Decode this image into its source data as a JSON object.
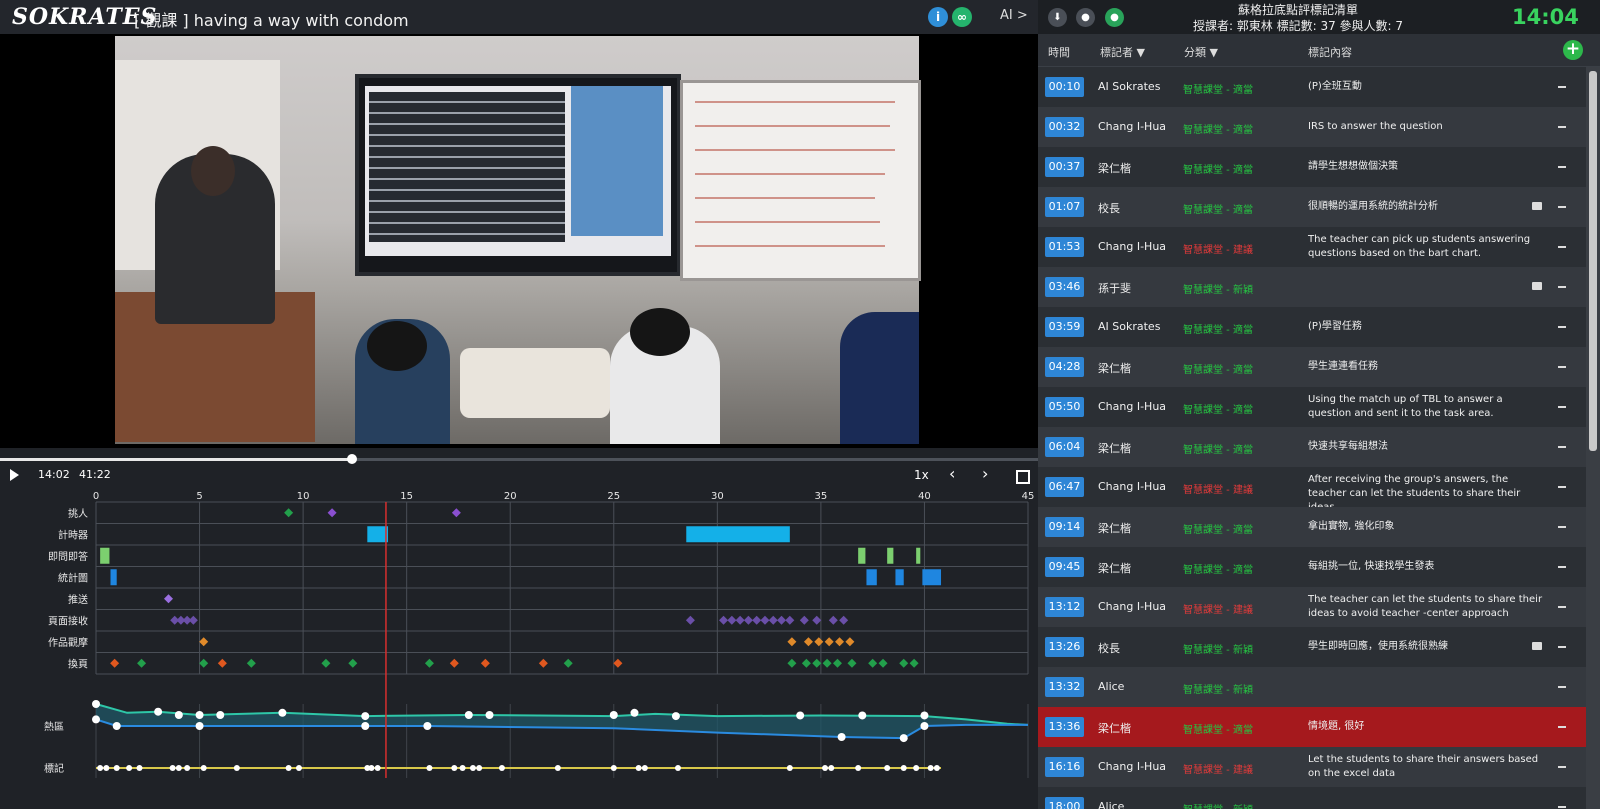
{
  "app": {
    "logo": "SOKRATES",
    "lesson_title": "[ 觀課 ] having a way with condom",
    "info_icon": "i",
    "link_icon": "∞",
    "ai_toggle": "AI >"
  },
  "player": {
    "current_time": "14:02",
    "total_time": "41:22",
    "progress_pct": 33.9,
    "speed": "1x",
    "prev_icon": "‹",
    "next_icon": "›"
  },
  "timeline": {
    "x_ticks": [
      0,
      5,
      10,
      15,
      20,
      25,
      30,
      35,
      40,
      45
    ],
    "x_max": 45,
    "playhead_min": 14.0,
    "rows": [
      {
        "label": "挑人",
        "marks": [
          {
            "t": 9.3,
            "c": "#22a04b",
            "s": "diamond"
          },
          {
            "t": 11.4,
            "c": "#8a4fd0",
            "s": "diamond"
          },
          {
            "t": 17.4,
            "c": "#8a4fd0",
            "s": "diamond"
          }
        ]
      },
      {
        "label": "計時器",
        "marks": [
          {
            "t": 13.1,
            "w": 1.0,
            "c": "#14b0e8",
            "s": "bar"
          },
          {
            "t": 28.5,
            "w": 5.0,
            "c": "#14b0e8",
            "s": "bar"
          }
        ]
      },
      {
        "label": "即問即答",
        "marks": [
          {
            "t": 0.2,
            "w": 0.45,
            "c": "#7ccf6f",
            "s": "bar"
          },
          {
            "t": 36.8,
            "w": 0.35,
            "c": "#7ccf6f",
            "s": "bar"
          },
          {
            "t": 38.2,
            "w": 0.3,
            "c": "#7ccf6f",
            "s": "bar"
          },
          {
            "t": 39.6,
            "w": 0.2,
            "c": "#7ccf6f",
            "s": "bar"
          }
        ]
      },
      {
        "label": "統計圖",
        "marks": [
          {
            "t": 0.7,
            "w": 0.3,
            "c": "#1f86e0",
            "s": "bar"
          },
          {
            "t": 37.2,
            "w": 0.5,
            "c": "#1f86e0",
            "s": "bar"
          },
          {
            "t": 38.6,
            "w": 0.4,
            "c": "#1f86e0",
            "s": "bar"
          },
          {
            "t": 39.9,
            "w": 0.9,
            "c": "#1f86e0",
            "s": "bar"
          }
        ]
      },
      {
        "label": "推送",
        "marks": [
          {
            "t": 3.5,
            "c": "#9a6fe0",
            "s": "diamond"
          }
        ]
      },
      {
        "label": "頁面接收",
        "marks": [
          {
            "t": 3.8,
            "c": "#6a4fa8",
            "s": "diamond"
          },
          {
            "t": 4.1,
            "c": "#6a4fa8",
            "s": "diamond"
          },
          {
            "t": 4.4,
            "c": "#6a4fa8",
            "s": "diamond"
          },
          {
            "t": 4.7,
            "c": "#6a4fa8",
            "s": "diamond"
          },
          {
            "t": 28.7,
            "c": "#6a4fa8",
            "s": "diamond"
          },
          {
            "t": 30.3,
            "c": "#6a4fa8",
            "s": "diamond"
          },
          {
            "t": 30.7,
            "c": "#6a4fa8",
            "s": "diamond"
          },
          {
            "t": 31.1,
            "c": "#6a4fa8",
            "s": "diamond"
          },
          {
            "t": 31.5,
            "c": "#6a4fa8",
            "s": "diamond"
          },
          {
            "t": 31.9,
            "c": "#6a4fa8",
            "s": "diamond"
          },
          {
            "t": 32.3,
            "c": "#6a4fa8",
            "s": "diamond"
          },
          {
            "t": 32.7,
            "c": "#6a4fa8",
            "s": "diamond"
          },
          {
            "t": 33.1,
            "c": "#6a4fa8",
            "s": "diamond"
          },
          {
            "t": 33.5,
            "c": "#6a4fa8",
            "s": "diamond"
          },
          {
            "t": 34.2,
            "c": "#6a4fa8",
            "s": "diamond"
          },
          {
            "t": 34.8,
            "c": "#6a4fa8",
            "s": "diamond"
          },
          {
            "t": 35.6,
            "c": "#6a4fa8",
            "s": "diamond"
          },
          {
            "t": 36.1,
            "c": "#6a4fa8",
            "s": "diamond"
          }
        ]
      },
      {
        "label": "作品觀摩",
        "marks": [
          {
            "t": 5.2,
            "c": "#e08a2a",
            "s": "diamond"
          },
          {
            "t": 33.6,
            "c": "#e08a2a",
            "s": "diamond"
          },
          {
            "t": 34.4,
            "c": "#e08a2a",
            "s": "diamond"
          },
          {
            "t": 34.9,
            "c": "#e08a2a",
            "s": "diamond"
          },
          {
            "t": 35.4,
            "c": "#e08a2a",
            "s": "diamond"
          },
          {
            "t": 35.9,
            "c": "#e08a2a",
            "s": "diamond"
          },
          {
            "t": 36.4,
            "c": "#e08a2a",
            "s": "diamond"
          }
        ]
      },
      {
        "label": "換頁",
        "marks": [
          {
            "t": 0.9,
            "c": "#e0581f",
            "s": "diamond"
          },
          {
            "t": 2.2,
            "c": "#22a04b",
            "s": "diamond"
          },
          {
            "t": 5.2,
            "c": "#22a04b",
            "s": "diamond"
          },
          {
            "t": 6.1,
            "c": "#e0581f",
            "s": "diamond"
          },
          {
            "t": 7.5,
            "c": "#22a04b",
            "s": "diamond"
          },
          {
            "t": 11.1,
            "c": "#22a04b",
            "s": "diamond"
          },
          {
            "t": 12.4,
            "c": "#22a04b",
            "s": "diamond"
          },
          {
            "t": 16.1,
            "c": "#22a04b",
            "s": "diamond"
          },
          {
            "t": 17.3,
            "c": "#e0581f",
            "s": "diamond"
          },
          {
            "t": 18.8,
            "c": "#e0581f",
            "s": "diamond"
          },
          {
            "t": 21.6,
            "c": "#e0581f",
            "s": "diamond"
          },
          {
            "t": 22.8,
            "c": "#22a04b",
            "s": "diamond"
          },
          {
            "t": 25.2,
            "c": "#e0581f",
            "s": "diamond"
          },
          {
            "t": 33.6,
            "c": "#22a04b",
            "s": "diamond"
          },
          {
            "t": 34.3,
            "c": "#22a04b",
            "s": "diamond"
          },
          {
            "t": 34.8,
            "c": "#22a04b",
            "s": "diamond"
          },
          {
            "t": 35.3,
            "c": "#22a04b",
            "s": "diamond"
          },
          {
            "t": 35.8,
            "c": "#22a04b",
            "s": "diamond"
          },
          {
            "t": 36.5,
            "c": "#22a04b",
            "s": "diamond"
          },
          {
            "t": 37.5,
            "c": "#22a04b",
            "s": "diamond"
          },
          {
            "t": 38.0,
            "c": "#22a04b",
            "s": "diamond"
          },
          {
            "t": 39.0,
            "c": "#22a04b",
            "s": "diamond"
          },
          {
            "t": 39.5,
            "c": "#22a04b",
            "s": "diamond"
          }
        ]
      }
    ],
    "heat_label": "熱區",
    "mark_label": "標記",
    "heat_upper": [
      [
        0,
        1.0
      ],
      [
        1.5,
        0.6
      ],
      [
        3,
        0.65
      ],
      [
        5,
        0.5
      ],
      [
        9,
        0.6
      ],
      [
        13,
        0.45
      ],
      [
        18,
        0.5
      ],
      [
        25,
        0.45
      ],
      [
        27,
        0.55
      ],
      [
        30,
        0.45
      ],
      [
        35,
        0.48
      ],
      [
        40,
        0.45
      ],
      [
        42,
        0.3
      ],
      [
        44,
        0.1
      ],
      [
        45,
        0.05
      ]
    ],
    "heat_lower": [
      [
        0,
        0.3
      ],
      [
        1,
        0.0
      ],
      [
        5,
        0
      ],
      [
        13,
        0
      ],
      [
        16,
        0
      ],
      [
        25,
        -0.1
      ],
      [
        30,
        -0.3
      ],
      [
        36,
        -0.5
      ],
      [
        39,
        -0.55
      ],
      [
        40,
        0.0
      ],
      [
        42,
        0.05
      ],
      [
        45,
        0.05
      ]
    ],
    "heat_points": [
      [
        0,
        1.0
      ],
      [
        0,
        0.3
      ],
      [
        1,
        0.0
      ],
      [
        3,
        0.65
      ],
      [
        4,
        0.5
      ],
      [
        5,
        0.5
      ],
      [
        5,
        0.0
      ],
      [
        6,
        0.5
      ],
      [
        9,
        0.6
      ],
      [
        13,
        0.45
      ],
      [
        13,
        0.0
      ],
      [
        16,
        0.0
      ],
      [
        18,
        0.5
      ],
      [
        19,
        0.5
      ],
      [
        25,
        0.5
      ],
      [
        26,
        0.6
      ],
      [
        28,
        0.45
      ],
      [
        34,
        0.48
      ],
      [
        36,
        -0.5
      ],
      [
        37,
        0.48
      ],
      [
        39,
        -0.55
      ],
      [
        40,
        0.48
      ],
      [
        40,
        0.0
      ]
    ],
    "mark_points": [
      0.2,
      0.5,
      1.0,
      1.6,
      2.1,
      3.7,
      4.0,
      4.4,
      5.2,
      6.8,
      9.3,
      9.8,
      13.1,
      13.3,
      13.6,
      16.1,
      17.3,
      17.7,
      18.2,
      18.5,
      19.6,
      22.3,
      25.0,
      26.2,
      26.5,
      28.1,
      33.5,
      35.2,
      35.5,
      36.8,
      38.2,
      39.0,
      39.6,
      40.3,
      40.6
    ]
  },
  "right_header": {
    "board_title": "蘇格拉底點評標記清單",
    "board_meta": "授課者: 郭東林  標記數: 37  參與人數: 7",
    "clock": "14:04"
  },
  "columns": {
    "time": "時間",
    "marker": "標記者",
    "category": "分類",
    "content": "標記內容"
  },
  "marks": [
    {
      "time": "00:10",
      "marker": "AI Sokrates",
      "category": "智慧課堂 - 適當",
      "cat_type": "ok",
      "content": "(P)全班互動",
      "img": false
    },
    {
      "time": "00:32",
      "marker": "Chang I-Hua",
      "category": "智慧課堂 - 適當",
      "cat_type": "ok",
      "content": "IRS to answer the question",
      "img": false
    },
    {
      "time": "00:37",
      "marker": "梁仁楷",
      "category": "智慧課堂 - 適當",
      "cat_type": "ok",
      "content": "請學生想想做個決策",
      "img": false
    },
    {
      "time": "01:07",
      "marker": "校長",
      "category": "智慧課堂 - 適當",
      "cat_type": "ok",
      "content": "很順暢的運用系統的統計分析",
      "img": true
    },
    {
      "time": "01:53",
      "marker": "Chang I-Hua",
      "category": "智慧課堂 - 建議",
      "cat_type": "bad",
      "content": "The teacher can pick up students answering questions based on the bart chart.",
      "img": false
    },
    {
      "time": "03:46",
      "marker": "孫于斐",
      "category": "智慧課堂 - 新穎",
      "cat_type": "ok",
      "content": "",
      "img": true
    },
    {
      "time": "03:59",
      "marker": "AI Sokrates",
      "category": "智慧課堂 - 適當",
      "cat_type": "ok",
      "content": "(P)學習任務",
      "img": false
    },
    {
      "time": "04:28",
      "marker": "梁仁楷",
      "category": "智慧課堂 - 適當",
      "cat_type": "ok",
      "content": "學生連連看任務",
      "img": false
    },
    {
      "time": "05:50",
      "marker": "Chang I-Hua",
      "category": "智慧課堂 - 適當",
      "cat_type": "ok",
      "content": "Using the match up of TBL to answer a question and sent it to the task area.",
      "img": false
    },
    {
      "time": "06:04",
      "marker": "梁仁楷",
      "category": "智慧課堂 - 適當",
      "cat_type": "ok",
      "content": "快速共享每組想法",
      "img": false
    },
    {
      "time": "06:47",
      "marker": "Chang I-Hua",
      "category": "智慧課堂 - 建議",
      "cat_type": "bad",
      "content": "After receiving the group's answers, the teacher can let the students to share their ideas.",
      "img": false
    },
    {
      "time": "09:14",
      "marker": "梁仁楷",
      "category": "智慧課堂 - 適當",
      "cat_type": "ok",
      "content": "拿出實物, 強化印象",
      "img": false
    },
    {
      "time": "09:45",
      "marker": "梁仁楷",
      "category": "智慧課堂 - 適當",
      "cat_type": "ok",
      "content": "每組挑一位, 快速找學生發表",
      "img": false
    },
    {
      "time": "13:12",
      "marker": "Chang I-Hua",
      "category": "智慧課堂 - 建議",
      "cat_type": "bad",
      "content": "The teacher can let the students to share their ideas to avoid teacher -center approach",
      "img": false
    },
    {
      "time": "13:26",
      "marker": "校長",
      "category": "智慧課堂 - 新穎",
      "cat_type": "ok",
      "content": "學生即時回應，使用系統很熟練",
      "img": true
    },
    {
      "time": "13:32",
      "marker": "Alice",
      "category": "智慧課堂 - 新穎",
      "cat_type": "ok",
      "content": "",
      "img": false
    },
    {
      "time": "13:36",
      "marker": "梁仁楷",
      "category": "智慧課堂 - 適當",
      "cat_type": "ok",
      "content": "情境題, 很好",
      "img": false,
      "active": true
    },
    {
      "time": "16:16",
      "marker": "Chang I-Hua",
      "category": "智慧課堂 - 建議",
      "cat_type": "bad",
      "content": "Let the students to share their answers based on the excel data",
      "img": false
    },
    {
      "time": "18:00",
      "marker": "Alice",
      "category": "智慧課堂 - 新穎",
      "cat_type": "ok",
      "content": "",
      "img": false
    }
  ]
}
